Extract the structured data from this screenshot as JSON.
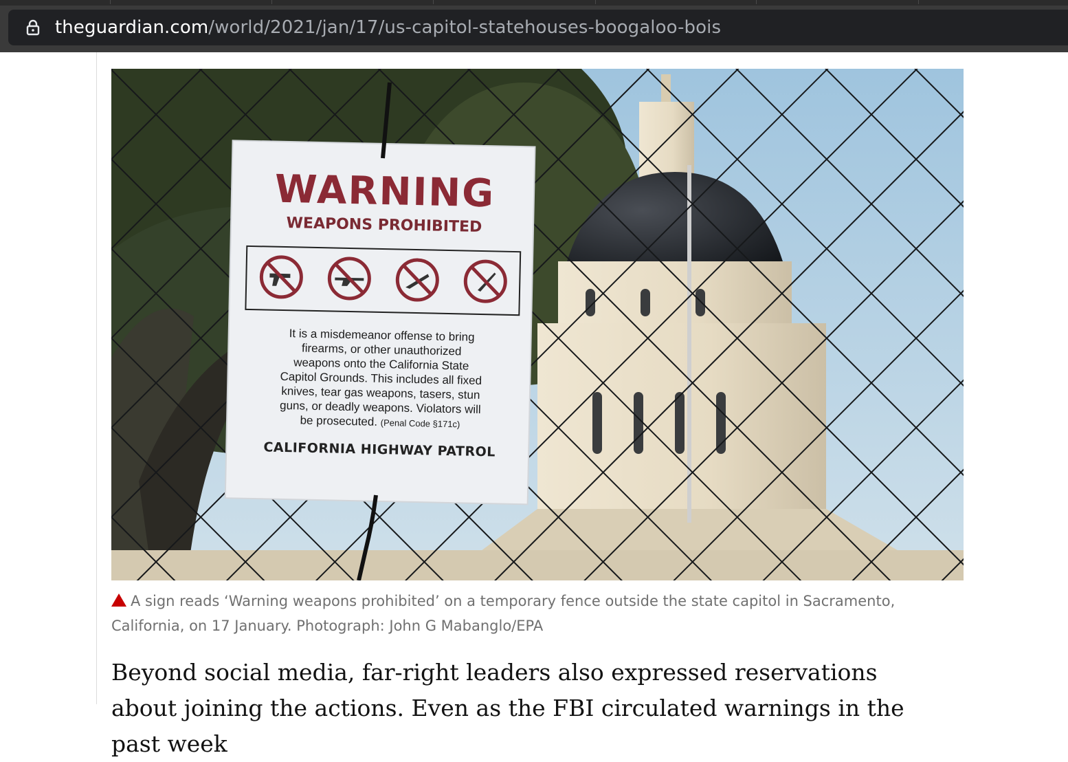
{
  "browser": {
    "url_host": "theguardian.com",
    "url_path": "/world/2021/jan/17/us-capitol-statehouses-boogaloo-bois",
    "lock_icon": "lock-icon"
  },
  "article": {
    "sign": {
      "title": "WARNING",
      "subtitle": "WEAPONS PROHIBITED",
      "body_lines": [
        "It is a misdemeanor offense to bring",
        "firearms, or other unauthorized",
        "weapons onto the California State",
        "Capitol Grounds.  This includes all fixed",
        "knives, tear gas weapons, tasers, stun",
        "guns, or deadly weapons.  Violators will",
        "be prosecuted."
      ],
      "code": "(Penal Code §171c)",
      "footer": "CALIFORNIA HIGHWAY PATROL",
      "icons": [
        "no-handgun-icon",
        "no-rifle-icon",
        "no-knife-icon",
        "no-dagger-icon"
      ]
    },
    "caption_icon": "triangle-icon",
    "caption_color": "#c70000",
    "caption": "A sign reads ‘Warning weapons prohibited’ on a temporary fence outside the state capitol in Sacramento, California, on 17 January. Photograph: John G Mabanglo/EPA",
    "paragraph": "Beyond social media, far-right leaders also expressed reservations about joining the actions. Even as the FBI circulated warnings in the past week"
  }
}
